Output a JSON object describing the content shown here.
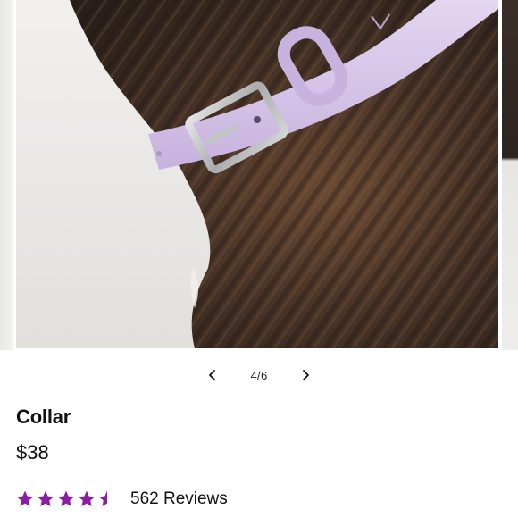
{
  "carousel": {
    "current_slide": 4,
    "total_slides": 6,
    "counter_text": "4/6",
    "image_subject": "lavender-collar-on-brindle-dog",
    "prev_icon": "chevron-left-icon",
    "next_icon": "chevron-right-icon"
  },
  "product": {
    "name": "Collar",
    "price": "$38"
  },
  "rating": {
    "value": 4.5,
    "max": 5,
    "star_color": "#8a1ea3",
    "reviews_text": "562 Reviews"
  },
  "colors": {
    "accent": "#8a1ea3",
    "collar": "#d7c6e8",
    "buckle": "#b9bbbd"
  }
}
